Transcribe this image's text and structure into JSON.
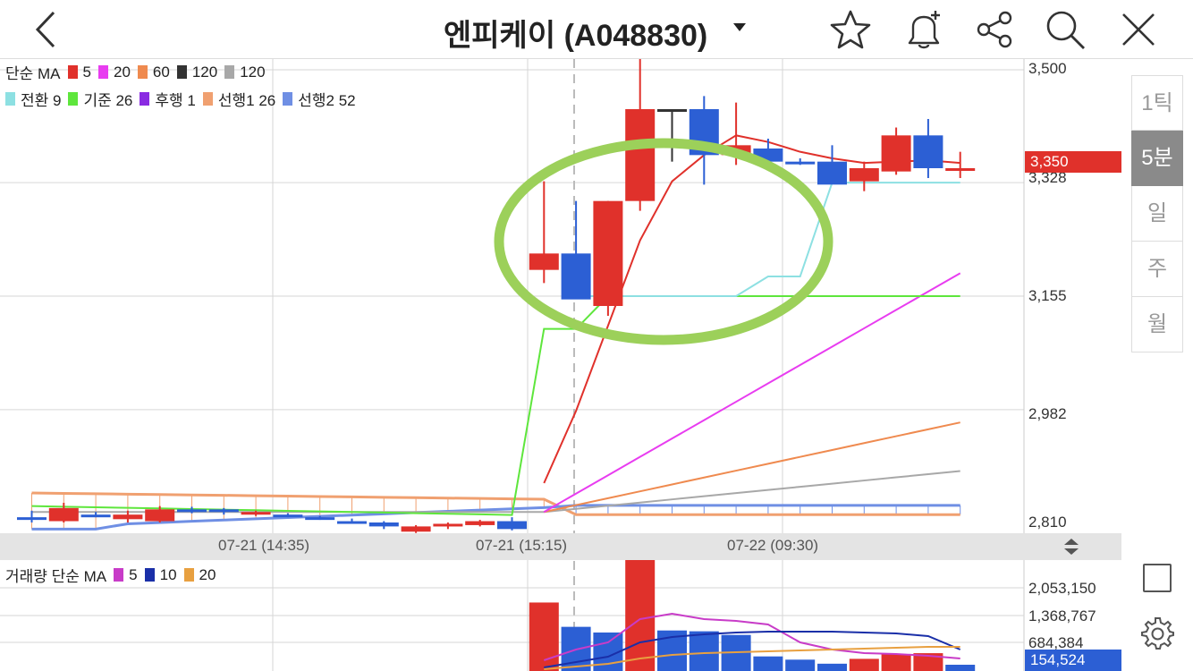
{
  "header": {
    "title": "엔피케이 (A048830)",
    "icons": [
      "back-chevron-icon",
      "star-icon",
      "bell-plus-icon",
      "share-icon",
      "search-icon",
      "close-icon"
    ]
  },
  "price_legend": {
    "row1_prefix": "단순 MA",
    "row1": [
      {
        "label": "5",
        "color": "#e0312b"
      },
      {
        "label": "20",
        "color": "#e83cf0"
      },
      {
        "label": "60",
        "color": "#ef8a4f"
      },
      {
        "label": "120",
        "color": "#333333"
      },
      {
        "label": "120",
        "color": "#a8a8a8"
      }
    ],
    "row2": [
      {
        "label": "전환 9",
        "color": "#8de0e2"
      },
      {
        "label": "기준 26",
        "color": "#5ee63c"
      },
      {
        "label": "후행 1",
        "color": "#8a2be2"
      },
      {
        "label": "선행1 26",
        "color": "#f0a070"
      },
      {
        "label": "선행2 52",
        "color": "#6f8fe4"
      }
    ]
  },
  "price_axis": {
    "ticks": [
      "3,500",
      "3,328",
      "3,155",
      "2,982",
      "2,810"
    ],
    "current_price": "3,350"
  },
  "date_axis": {
    "labels": [
      "07-21 (14:35)",
      "07-21 (15:15)",
      "07-22 (09:30)"
    ]
  },
  "volume_legend": {
    "prefix": "거래량 단순 MA",
    "items": [
      {
        "label": "5",
        "color": "#c83cc8"
      },
      {
        "label": "10",
        "color": "#1a2fa8"
      },
      {
        "label": "20",
        "color": "#e8a040"
      }
    ]
  },
  "volume_axis": {
    "ticks": [
      "2,053,150",
      "1,368,767",
      "684,384"
    ],
    "current_volume": "154,524"
  },
  "periods": [
    {
      "label": "1틱",
      "active": false
    },
    {
      "label": "5분",
      "active": true
    },
    {
      "label": "일",
      "active": false
    },
    {
      "label": "주",
      "active": false
    },
    {
      "label": "월",
      "active": false
    }
  ],
  "colors": {
    "up": "#e0312b",
    "down": "#2c5fd4",
    "annotation": "#9cd05a"
  },
  "chart_data": {
    "type": "candlestick",
    "interval": "5분",
    "price_range": [
      2810,
      3500
    ],
    "candles": [
      {
        "o": 2818,
        "h": 2828,
        "l": 2810,
        "c": 2815,
        "dir": "down"
      },
      {
        "o": 2812,
        "h": 2840,
        "l": 2810,
        "c": 2832,
        "dir": "up"
      },
      {
        "o": 2822,
        "h": 2826,
        "l": 2818,
        "c": 2820,
        "dir": "down"
      },
      {
        "o": 2815,
        "h": 2828,
        "l": 2810,
        "c": 2822,
        "dir": "up"
      },
      {
        "o": 2812,
        "h": 2835,
        "l": 2810,
        "c": 2830,
        "dir": "up"
      },
      {
        "o": 2830,
        "h": 2834,
        "l": 2824,
        "c": 2826,
        "dir": "down"
      },
      {
        "o": 2830,
        "h": 2832,
        "l": 2822,
        "c": 2826,
        "dir": "down"
      },
      {
        "o": 2824,
        "h": 2828,
        "l": 2820,
        "c": 2826,
        "dir": "up"
      },
      {
        "o": 2822,
        "h": 2824,
        "l": 2818,
        "c": 2820,
        "dir": "down"
      },
      {
        "o": 2818,
        "h": 2820,
        "l": 2814,
        "c": 2815,
        "dir": "down"
      },
      {
        "o": 2812,
        "h": 2816,
        "l": 2808,
        "c": 2810,
        "dir": "down"
      },
      {
        "o": 2810,
        "h": 2812,
        "l": 2800,
        "c": 2804,
        "dir": "down"
      },
      {
        "o": 2796,
        "h": 2806,
        "l": 2794,
        "c": 2804,
        "dir": "up"
      },
      {
        "o": 2806,
        "h": 2810,
        "l": 2800,
        "c": 2808,
        "dir": "up"
      },
      {
        "o": 2806,
        "h": 2814,
        "l": 2804,
        "c": 2812,
        "dir": "up"
      },
      {
        "o": 2812,
        "h": 2818,
        "l": 2798,
        "c": 2800,
        "dir": "down"
      },
      {
        "o": 3195,
        "h": 3330,
        "l": 3175,
        "c": 3220,
        "dir": "up"
      },
      {
        "o": 3220,
        "h": 3300,
        "l": 3155,
        "c": 3150,
        "dir": "down"
      },
      {
        "o": 3140,
        "h": 3300,
        "l": 3125,
        "c": 3300,
        "dir": "up"
      },
      {
        "o": 3300,
        "h": 3518,
        "l": 3285,
        "c": 3440,
        "dir": "up"
      },
      {
        "o": 3440,
        "h": 3440,
        "l": 3360,
        "c": 3440,
        "dir": "doji"
      },
      {
        "o": 3440,
        "h": 3460,
        "l": 3325,
        "c": 3370,
        "dir": "down"
      },
      {
        "o": 3370,
        "h": 3450,
        "l": 3355,
        "c": 3385,
        "dir": "up"
      },
      {
        "o": 3380,
        "h": 3395,
        "l": 3355,
        "c": 3360,
        "dir": "down"
      },
      {
        "o": 3360,
        "h": 3365,
        "l": 3355,
        "c": 3357,
        "dir": "down"
      },
      {
        "o": 3360,
        "h": 3385,
        "l": 3333,
        "c": 3325,
        "dir": "down"
      },
      {
        "o": 3330,
        "h": 3360,
        "l": 3315,
        "c": 3350,
        "dir": "up"
      },
      {
        "o": 3345,
        "h": 3412,
        "l": 3340,
        "c": 3400,
        "dir": "up"
      },
      {
        "o": 3400,
        "h": 3425,
        "l": 3335,
        "c": 3350,
        "dir": "down"
      },
      {
        "o": 3350,
        "h": 3375,
        "l": 3335,
        "c": 3350,
        "dir": "up"
      }
    ],
    "volume_range": [
      0,
      2737533
    ],
    "volumes": [
      0,
      0,
      0,
      0,
      0,
      0,
      0,
      0,
      0,
      0,
      0,
      0,
      0,
      0,
      0,
      0,
      1690000,
      1090000,
      950000,
      3030000,
      1000000,
      980000,
      890000,
      360000,
      280000,
      180000,
      300000,
      420000,
      440000,
      154524
    ],
    "volume_dirs": [
      "down",
      "up",
      "down",
      "up",
      "up",
      "down",
      "down",
      "up",
      "down",
      "down",
      "down",
      "down",
      "up",
      "up",
      "up",
      "down",
      "up",
      "down",
      "down",
      "up",
      "down",
      "down",
      "down",
      "down",
      "down",
      "down",
      "up",
      "up",
      "up",
      "down"
    ]
  }
}
